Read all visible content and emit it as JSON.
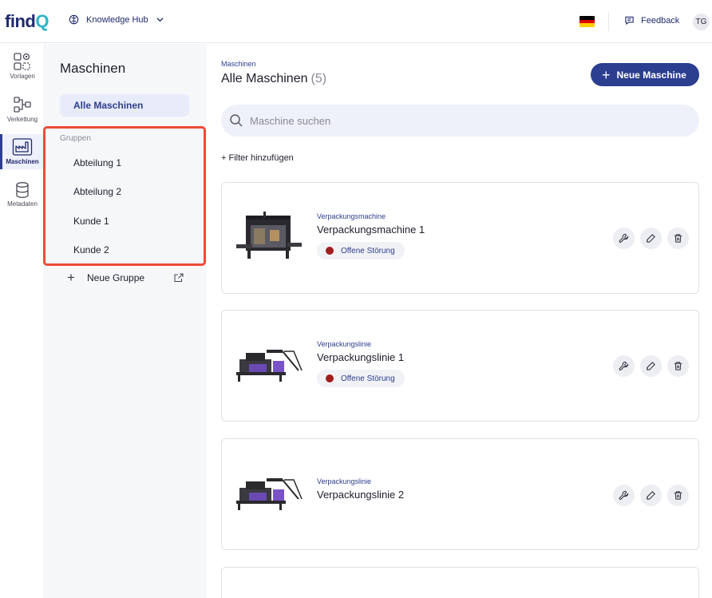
{
  "header": {
    "logo_main": "find",
    "logo_accent": "Q",
    "workspace": "Knowledge Hub",
    "language_flag": "de-flag-icon",
    "feedback_label": "Feedback",
    "user_initials": "TG"
  },
  "rail": {
    "items": [
      {
        "label": "Vorlagen",
        "icon": "templates-icon"
      },
      {
        "label": "Verkettung",
        "icon": "chain-icon"
      },
      {
        "label": "Maschinen",
        "icon": "factory-icon",
        "active": true
      },
      {
        "label": "Metadaten",
        "icon": "database-icon"
      }
    ]
  },
  "panel": {
    "title": "Maschinen",
    "all_label": "Alle Maschinen",
    "groups_label": "Gruppen",
    "groups": [
      "Abteilung 1",
      "Abteilung 2",
      "Kunde 1",
      "Kunde 2"
    ],
    "new_group_label": "Neue Gruppe"
  },
  "main": {
    "breadcrumb": "Maschinen",
    "title": "Alle Maschinen",
    "count": "(5)",
    "new_button": "Neue Maschine",
    "search_placeholder": "Maschine suchen",
    "filter_label": "+ Filter hinzufügen",
    "cards": [
      {
        "type": "Verpackungsmachine",
        "name": "Verpackungsmachine 1",
        "status": "Offene Störung",
        "image": "packaging-machine-image"
      },
      {
        "type": "Verpackungslinie",
        "name": "Verpackungslinie 1",
        "status": "Offene Störung",
        "image": "packaging-line-image"
      },
      {
        "type": "Verpackungslinie",
        "name": "Verpackungslinie 2",
        "status": "",
        "image": "packaging-line-image"
      }
    ]
  },
  "colors": {
    "brand": "#1f2a6d",
    "accent": "#2c3e8f",
    "highlight_border": "#ef4b36",
    "status_error": "#a11d1d"
  }
}
